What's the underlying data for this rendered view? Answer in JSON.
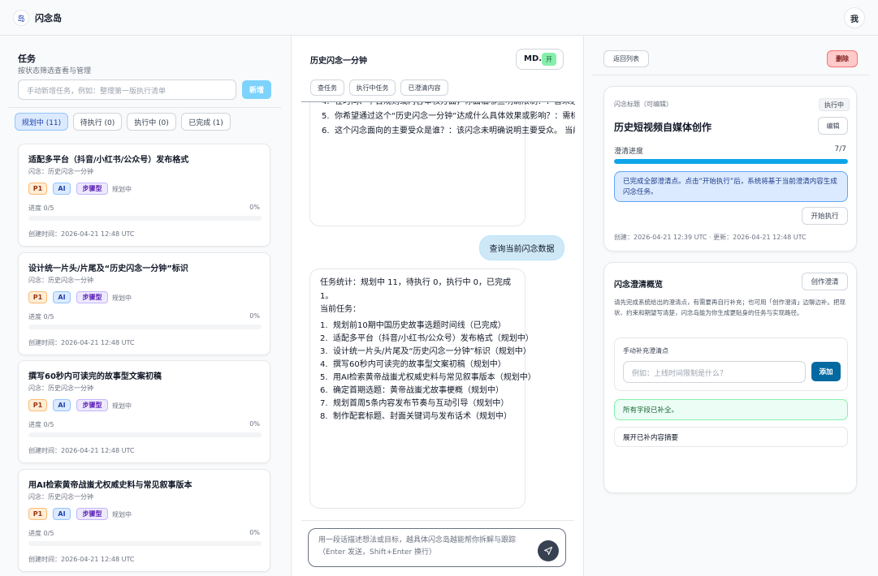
{
  "app": {
    "logo_glyph": "岛",
    "name": "闪念岛",
    "avatar_label": "我"
  },
  "tasks_panel": {
    "title": "任务",
    "subtitle": "按状态筛选查看与管理",
    "new_task_placeholder": "手动新增任务，例如：整理第一版执行清单",
    "new_button": "新增",
    "filters": [
      {
        "label": "规划中 (11)",
        "active": true
      },
      {
        "label": "待执行 (0)",
        "active": false
      },
      {
        "label": "执行中 (0)",
        "active": false
      },
      {
        "label": "已完成 (1)",
        "active": false
      }
    ],
    "cards": [
      {
        "title": "适配多平台（抖音/小红书/公众号）发布格式",
        "sub": "闪念：历史闪念一分钟",
        "priority": "P1",
        "ai": "AI",
        "type": "步骤型",
        "status": "规划中",
        "progress_label": "进度 0/5",
        "progress_pct": "0%",
        "created": "创建时间：2026-04-21 12:48 UTC"
      },
      {
        "title": "设计统一片头/片尾及“历史闪念一分钟”标识",
        "sub": "闪念：历史闪念一分钟",
        "priority": "P1",
        "ai": "AI",
        "type": "步骤型",
        "status": "规划中",
        "progress_label": "进度 0/5",
        "progress_pct": "0%",
        "created": "创建时间：2026-04-21 12:48 UTC"
      },
      {
        "title": "撰写60秒内可读完的故事型文案初稿",
        "sub": "闪念：历史闪念一分钟",
        "priority": "P1",
        "ai": "AI",
        "type": "步骤型",
        "status": "规划中",
        "progress_label": "进度 0/5",
        "progress_pct": "0%",
        "created": "创建时间：2026-04-21 12:48 UTC"
      },
      {
        "title": "用AI检索黄帝战蚩尤权威史料与常见叙事版本",
        "sub": "闪念：历史闪念一分钟",
        "priority": "P1",
        "ai": "AI",
        "type": "步骤型",
        "status": "规划中",
        "progress_label": "进度 0/5",
        "progress_pct": "0%",
        "created": "创建时间：2026-04-21 12:48 UTC"
      }
    ]
  },
  "chat": {
    "title": "历史闪念一分钟",
    "md_label": "MD.",
    "md_toggle": "开",
    "quick_actions": [
      "查任务",
      "执行中任务",
      "已澄清内容"
    ],
    "msg1": [
      {
        "n": "4.",
        "text": "在时间、平台规则或内容审核方面，你面临哪些明确限制？：暂未遇到明确的时间、平台规则或内容审核限制。"
      },
      {
        "n": "5.",
        "text": "你希望通过这个“历史闪念一分钟”达成什么具体效果或影响？：需标注“历史闪念一分钟”的具体效果或影响。"
      },
      {
        "n": "6.",
        "text": "这个闪念面向的主要受众是谁？：该闪念未明确说明主要受众。 当前澄清点已全部补全。"
      }
    ],
    "user_msg": "查询当前闪念数据",
    "msg2_stats": "任务统计：规划中 11，待执行 0，执行中 0，已完成 1。",
    "msg2_heading": "当前任务：",
    "msg2_items": [
      {
        "n": "1.",
        "text": "规划前10期中国历史故事选题时间线（已完成）"
      },
      {
        "n": "2.",
        "text": "适配多平台（抖音/小红书/公众号）发布格式（规划中）"
      },
      {
        "n": "3.",
        "text": "设计统一片头/片尾及“历史闪念一分钟”标识（规划中）"
      },
      {
        "n": "4.",
        "text": "撰写60秒内可读完的故事型文案初稿（规划中）"
      },
      {
        "n": "5.",
        "text": "用AI检索黄帝战蚩尤权威史料与常见叙事版本（规划中）"
      },
      {
        "n": "6.",
        "text": "确定首期选题：黄帝战蚩尤故事梗概（规划中）"
      },
      {
        "n": "7.",
        "text": "规划首周5条内容发布节奏与互动引导（规划中）"
      },
      {
        "n": "8.",
        "text": "制作配套标题、封面关键词与发布话术（规划中）"
      }
    ],
    "input_placeholder": "用一段话描述想法或目标，越具体闪念岛越能帮你拆解与跟踪（Enter 发送，Shift+Enter 换行）"
  },
  "detail": {
    "back_button": "返回列表",
    "delete_button": "删除",
    "idea_label": "闪念标题（可编辑）",
    "status_badge": "执行中",
    "idea_title": "历史短视频自媒体创作",
    "edit_button": "编辑",
    "progress_label": "澄清进度",
    "progress_value": "7/7",
    "progress_fraction": 1.0,
    "info_box": "已完成全部澄清点。点击“开始执行”后，系统将基于当前澄清内容生成闪念任务。",
    "start_button": "开始执行",
    "timestamps": "创建：2026-04-21 12:39 UTC · 更新：2026-04-21 12:48 UTC",
    "overview_title": "闪念澄清概览",
    "create_clarify_button": "创作澄清",
    "overview_desc": "请先完成系统给出的澄清点，有需要再自行补充；也可用「创作澄清」边聊边补。把现状、约束和期望写清楚，闪念岛能为你生成更贴身的任务与实现路径。",
    "manual_label": "手动补充澄清点",
    "manual_placeholder": "例如：上线时间限制是什么？",
    "add_button": "添加",
    "success_box": "所有字段已补全。",
    "expand_button": "展开已补内容摘要"
  },
  "colors": {
    "accent": "#0ea5e9",
    "primary_btn": "#0369a1",
    "danger_bg": "#fecaca",
    "info_bg": "#dbeafe",
    "success_bg": "#ecfdf5"
  }
}
